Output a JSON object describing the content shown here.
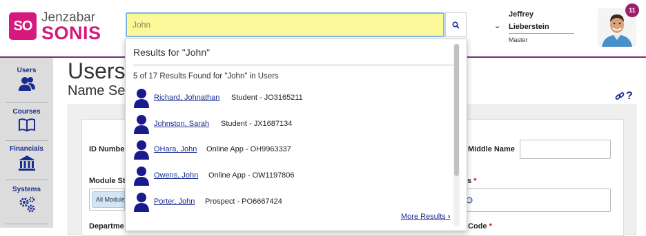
{
  "brand": {
    "logo_mark": "SO",
    "name_top": "Jenzabar",
    "name_bottom": "SONIS",
    "color": "#d6197d"
  },
  "search": {
    "value": "John",
    "button_icon": "search-icon"
  },
  "user": {
    "first_name": "Jeffrey",
    "last_name": "Lieberstein",
    "role": "Master",
    "notification_count": "11"
  },
  "sidebar": {
    "items": [
      {
        "label": "Users",
        "icon": "users-icon"
      },
      {
        "label": "Courses",
        "icon": "book-icon"
      },
      {
        "label": "Financials",
        "icon": "bank-icon"
      },
      {
        "label": "Systems",
        "icon": "gears-icon"
      }
    ]
  },
  "page": {
    "title": "Users",
    "subtitle": "Name Se",
    "link_icon": "link-icon",
    "help_icon": "?"
  },
  "form": {
    "id_label": "ID Number",
    "middle_label": "Middle Name",
    "module_label": "Module St",
    "module_value": "All Module",
    "right_label_tail": "s",
    "right_required": "*",
    "bottom_left_label": "Departme",
    "bottom_right_label": "Code",
    "bottom_right_required": "*"
  },
  "results": {
    "title": "Results for \"John\"",
    "count_text": "5 of 17 Results Found for \"John\" in Users",
    "items": [
      {
        "name": "Richard, Johnathan",
        "desc": "Student - JO3165211"
      },
      {
        "name": "Johnston, Sarah",
        "desc": "Student - JX1687134"
      },
      {
        "name": "OHara, John",
        "desc": "Online App - OH9963337"
      },
      {
        "name": "Owens, John",
        "desc": "Online App - OW1197806"
      },
      {
        "name": "Porter, John",
        "desc": "Prospect - PO6667424"
      }
    ],
    "more_label": "More Results"
  },
  "colors": {
    "accent": "#1a2b8f",
    "header_rule": "#7b2d6b",
    "search_bg": "#fbf89a"
  }
}
